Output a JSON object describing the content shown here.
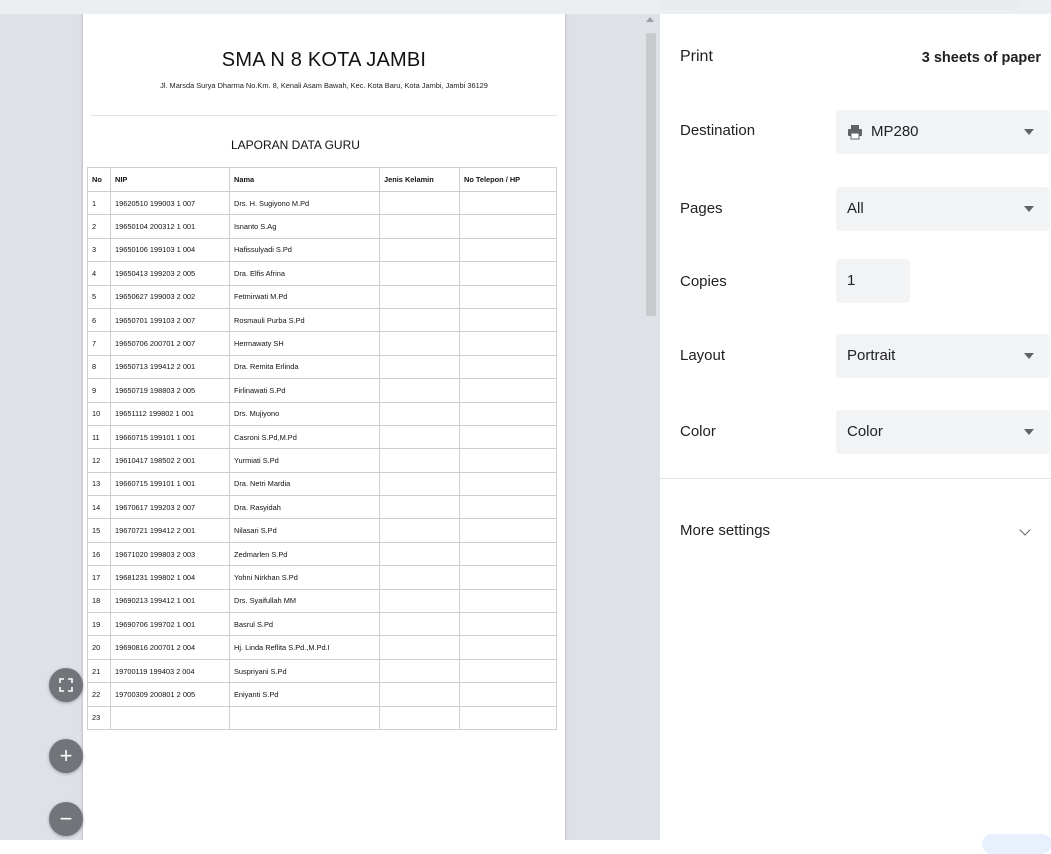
{
  "document": {
    "school_title": "SMA N 8 KOTA JAMBI",
    "school_address": "Jl. Marsda Surya Dharma No.Km. 8, Kenali Asam Bawah, Kec. Kota Baru, Kota Jambi, Jambi 36129",
    "report_title": "LAPORAN DATA GURU",
    "columns": [
      "No",
      "NIP",
      "Nama",
      "Jenis Kelamin",
      "No Telepon / HP"
    ],
    "rows": [
      [
        "1",
        "19620510 199003 1 007",
        "Drs. H. Sugiyono M.Pd",
        "",
        ""
      ],
      [
        "2",
        "19650104 200312 1 001",
        "Isnanto S.Ag",
        "",
        ""
      ],
      [
        "3",
        "19650106 199103 1 004",
        "Hafissulyadi S.Pd",
        "",
        ""
      ],
      [
        "4",
        "19650413 199203 2 005",
        "Dra. Elfis Afrina",
        "",
        ""
      ],
      [
        "5",
        "19650627 199003 2 002",
        "Fetmirwati M.Pd",
        "",
        ""
      ],
      [
        "6",
        "19650701 199103 2 007",
        "Rosmauli Purba S.Pd",
        "",
        ""
      ],
      [
        "7",
        "19650706 200701 2 007",
        "Hermawaty SH",
        "",
        ""
      ],
      [
        "8",
        "19650713 199412 2 001",
        "Dra. Remita Erlinda",
        "",
        ""
      ],
      [
        "9",
        "19650719 198803 2 005",
        "Firlinawati S.Pd",
        "",
        ""
      ],
      [
        "10",
        "19651112 199802 1 001",
        "Drs. Mujiyono",
        "",
        ""
      ],
      [
        "11",
        "19660715 199101 1 001",
        "Casroni S.Pd,M.Pd",
        "",
        ""
      ],
      [
        "12",
        "19610417 198502 2 001",
        "Yurmiati S.Pd",
        "",
        ""
      ],
      [
        "13",
        "19660715 199101 1 001",
        "Dra. Netri Mardia",
        "",
        ""
      ],
      [
        "14",
        "19670617 199203 2 007",
        "Dra. Rasyidah",
        "",
        ""
      ],
      [
        "15",
        "19670721 199412 2 001",
        "Nilasari S.Pd",
        "",
        ""
      ],
      [
        "16",
        "19671020 199803 2 003",
        "Zedmarlen S.Pd",
        "",
        ""
      ],
      [
        "17",
        "19681231 199802 1 004",
        "Yohni Nirkhan S.Pd",
        "",
        ""
      ],
      [
        "18",
        "19690213 199412 1 001",
        "Drs. Syaifullah MM",
        "",
        ""
      ],
      [
        "19",
        "19690706 199702 1 001",
        "Basrul S.Pd",
        "",
        ""
      ],
      [
        "20",
        "19690816 200701 2 004",
        "Hj. Linda Reflita S.Pd.,M.Pd.I",
        "",
        ""
      ],
      [
        "21",
        "19700119 199403 2 004",
        "Suspriyani S.Pd",
        "",
        ""
      ],
      [
        "22",
        "19700309 200801 2 005",
        "Eniyanti S.Pd",
        "",
        ""
      ],
      [
        "23",
        "",
        "",
        "",
        ""
      ]
    ]
  },
  "zoom": {
    "fit_icon": "fit-to-page-icon",
    "zoom_in_symbol": "+",
    "zoom_out_symbol": "−"
  },
  "settings": {
    "title": "Print",
    "sheets": "3 sheets of paper",
    "destination_label": "Destination",
    "destination_value": "MP280",
    "destination_icon": "printer-icon",
    "pages_label": "Pages",
    "pages_value": "All",
    "copies_label": "Copies",
    "copies_value": "1",
    "layout_label": "Layout",
    "layout_value": "Portrait",
    "color_label": "Color",
    "color_value": "Color",
    "more_settings": "More settings"
  },
  "colors": {
    "preview_bg": "#dee1e6",
    "select_bg": "#f1f3f4",
    "zoom_button": "#717478"
  }
}
